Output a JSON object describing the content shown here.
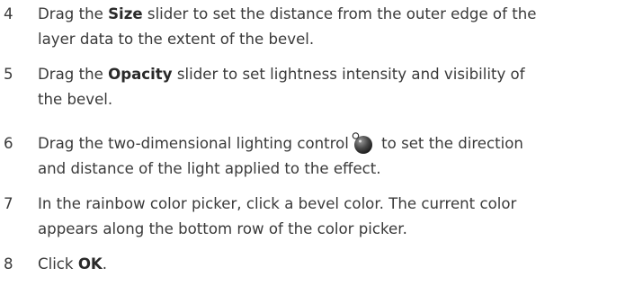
{
  "steps": [
    {
      "number": "4",
      "line1_pre": "Drag the ",
      "line1_bold": "Size",
      "line1_post": " slider to set the distance from the outer edge of the",
      "line2": "layer data to the extent of the bevel."
    },
    {
      "number": "5",
      "line1_pre": "Drag the ",
      "line1_bold": "Opacity",
      "line1_post": " slider to set lightness intensity and visibility of",
      "line2": "the bevel."
    },
    {
      "number": "6",
      "line1_pre": "Drag the two-dimensional lighting control",
      "icon": "lighting-control-icon",
      "line1_post": " to set the direction",
      "line2": "and distance of the light applied to the effect."
    },
    {
      "number": "7",
      "line1": "In the rainbow color picker, click a bevel color. The current color",
      "line2": "appears along the bottom row of the color picker."
    },
    {
      "number": "8",
      "line1_pre": "Click ",
      "line1_bold": "OK",
      "line1_post": "."
    }
  ]
}
